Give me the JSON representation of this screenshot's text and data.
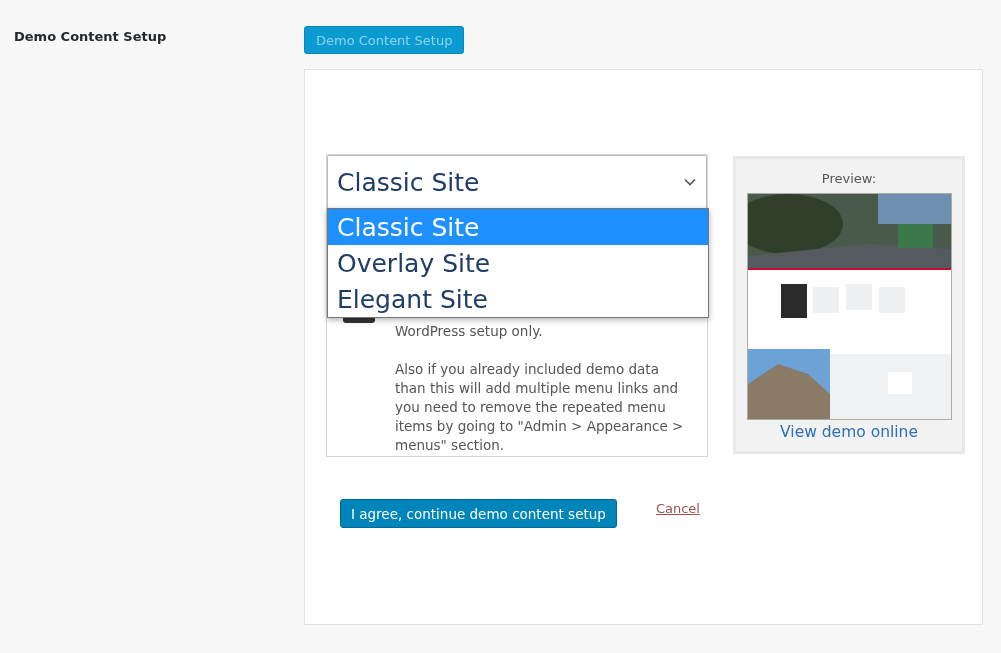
{
  "section_label": "Demo Content Setup",
  "setup_button": {
    "label": "Demo Content Setup",
    "disabled": true
  },
  "site_select": {
    "value": "Classic Site",
    "expanded": true,
    "options": [
      {
        "label": "Classic Site",
        "selected": true
      },
      {
        "label": "Overlay Site",
        "selected": false
      },
      {
        "label": "Elegant Site",
        "selected": false
      }
    ]
  },
  "notice": {
    "paragraphs": [
      "WordPress setup only.",
      "Also if you already included demo data than this will add multiple menu links and you need to remove the repeated menu items by going to \"Admin > Appearance > menus\" section."
    ]
  },
  "preview": {
    "title": "Preview:",
    "link": "View demo online"
  },
  "actions": {
    "agree": "I agree, continue demo content setup",
    "cancel": "Cancel"
  }
}
